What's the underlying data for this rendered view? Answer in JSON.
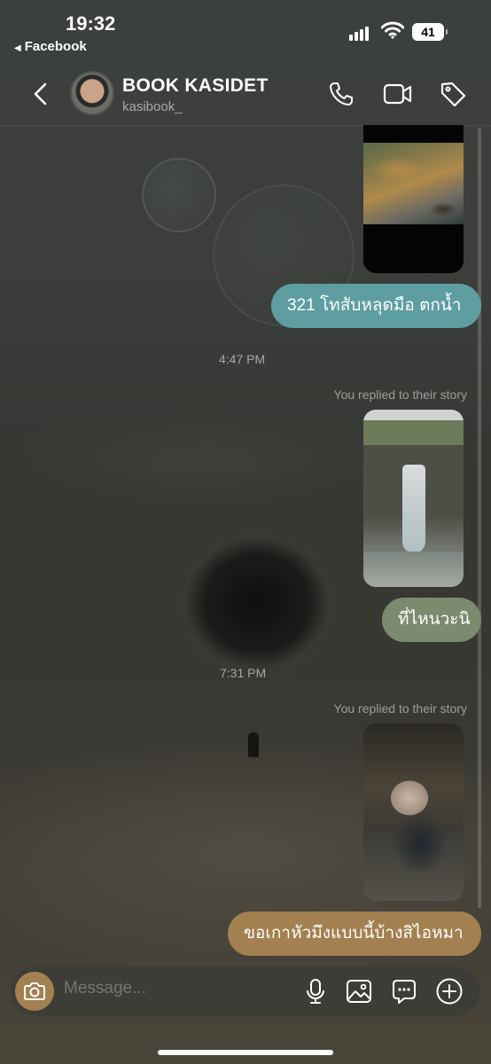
{
  "status_bar": {
    "time": "19:32",
    "back_app": "Facebook",
    "battery": "41"
  },
  "header": {
    "name": "BOOK KASIDET",
    "username": "kasibook_"
  },
  "messages": [
    {
      "type": "story_image",
      "subject": "stream-rocks"
    },
    {
      "type": "text",
      "text": "321 โทสับหลุดมือ ตกน้ำ",
      "color": "#5e9ea1"
    },
    {
      "type": "timestamp",
      "text": "4:47 PM"
    },
    {
      "type": "reply_note",
      "text": "You replied to their story"
    },
    {
      "type": "story_image",
      "subject": "waterfall"
    },
    {
      "type": "text",
      "text": "ที่ไหนวะนิ",
      "color": "#7c8a70"
    },
    {
      "type": "timestamp",
      "text": "7:31 PM"
    },
    {
      "type": "reply_note",
      "text": "You replied to their story"
    },
    {
      "type": "story_image",
      "subject": "dog"
    },
    {
      "type": "text",
      "text": "ขอเกาหัวมึงแบบนี้บ้างสิไอหมา",
      "color": "#a3804f"
    }
  ],
  "composer": {
    "placeholder": "Message...",
    "accent": "#a3804f"
  },
  "icons": {
    "header": [
      "chevron-left-icon",
      "phone-icon",
      "video-icon",
      "tag-icon"
    ],
    "composer": [
      "camera-icon",
      "microphone-icon",
      "gallery-icon",
      "sticker-icon",
      "plus-icon"
    ]
  }
}
